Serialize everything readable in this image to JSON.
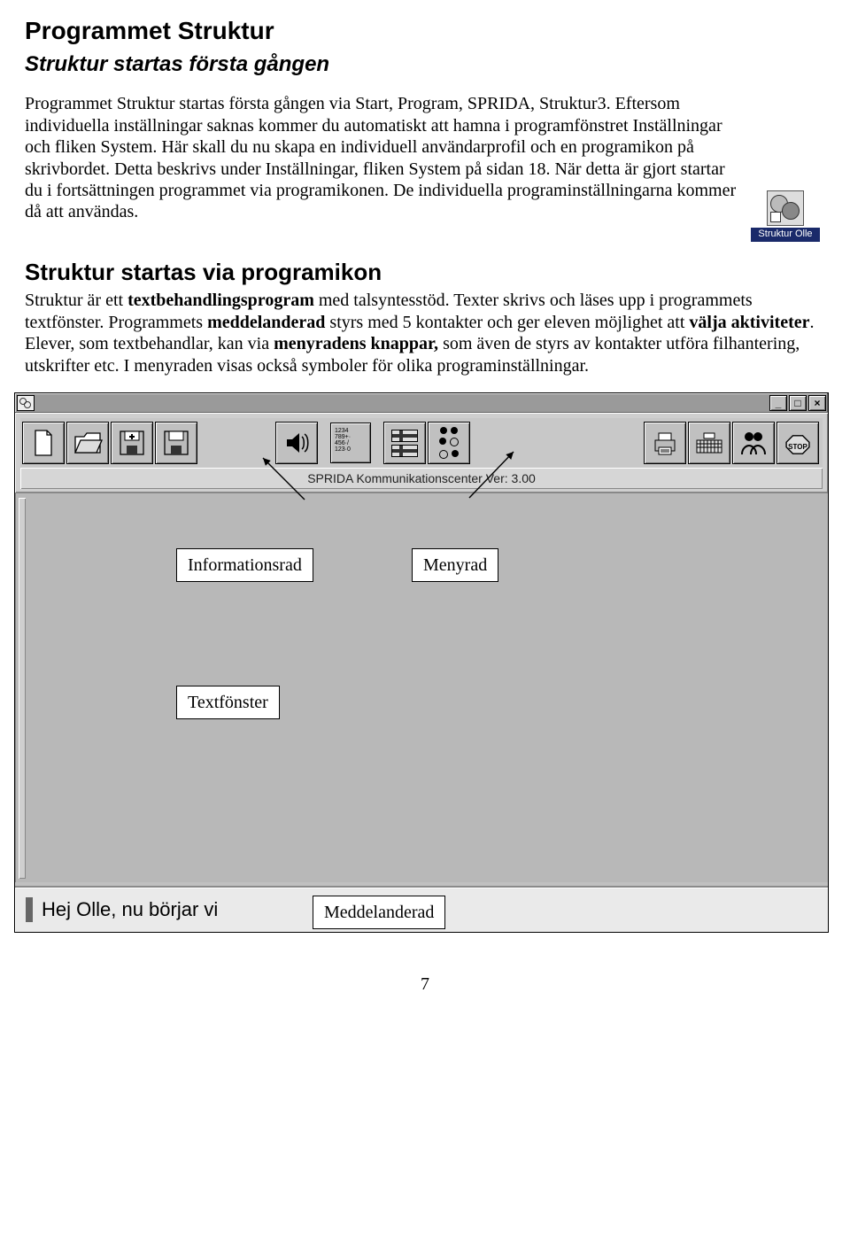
{
  "h1": "Programmet Struktur",
  "h2a": "Struktur startas första gången",
  "p1": "Programmet Struktur startas första gången via Start, Program, SPRIDA, Struktur3. Eftersom individuella inställningar saknas kommer du automatiskt att hamna i programfönstret Inställningar och fliken System. Här skall du nu skapa en individuell användarprofil och en programikon på skrivbordet. Detta beskrivs under Inställningar, fliken System på sidan 18. När detta är gjort startar du i fortsättningen programmet via programikonen. De individuella programinställningarna kommer då att användas.",
  "icon_label": "Struktur Olle",
  "h2b": "Struktur startas via programikon",
  "p2_a": "Struktur är ett ",
  "p2_b": "textbehandlingsprogram",
  "p2_c": " med talsyntesstöd. Texter skrivs och läses upp i programmets textfönster. Programmets ",
  "p2_d": "meddelanderad",
  "p2_e": "  styrs med 5 kontakter och ger eleven möjlighet att ",
  "p2_f": "välja aktiviteter",
  "p2_g": ". Elever, som textbehandlar, kan via ",
  "p2_h": "menyradens knappar,",
  "p2_i": " som även de styrs av kontakter utföra filhantering, utskrifter etc.  I menyraden visas också symboler för olika programinställningar.",
  "titlebar": "",
  "win_min": "_",
  "win_max": "□",
  "win_close": "×",
  "toolbar_icons": {
    "new": "new-file-icon",
    "open": "open-folder-icon",
    "saveplus": "save-plus-icon",
    "save": "save-icon",
    "speak": "speaker-icon",
    "numbers": "numbers-icon",
    "flag1": "flag-se-icon",
    "flag2": "flag-fi-icon",
    "dots1": "braille-icon",
    "dots2": "braille2-icon",
    "print": "print-icon",
    "keyboard": "keyboard-icon",
    "users": "users-icon",
    "stop": "stop-icon"
  },
  "num_block": "1234\n789+·\n456·/\n123·0",
  "infobar": "SPRIDA Kommunikationscenter    Ver: 3.00",
  "message": "Hej Olle, nu börjar vi",
  "callouts": {
    "info": "Informationsrad",
    "menu": "Menyrad",
    "text": "Textfönster",
    "msg": "Meddelanderad"
  },
  "stop_label": "STOP",
  "pagenum": "7"
}
